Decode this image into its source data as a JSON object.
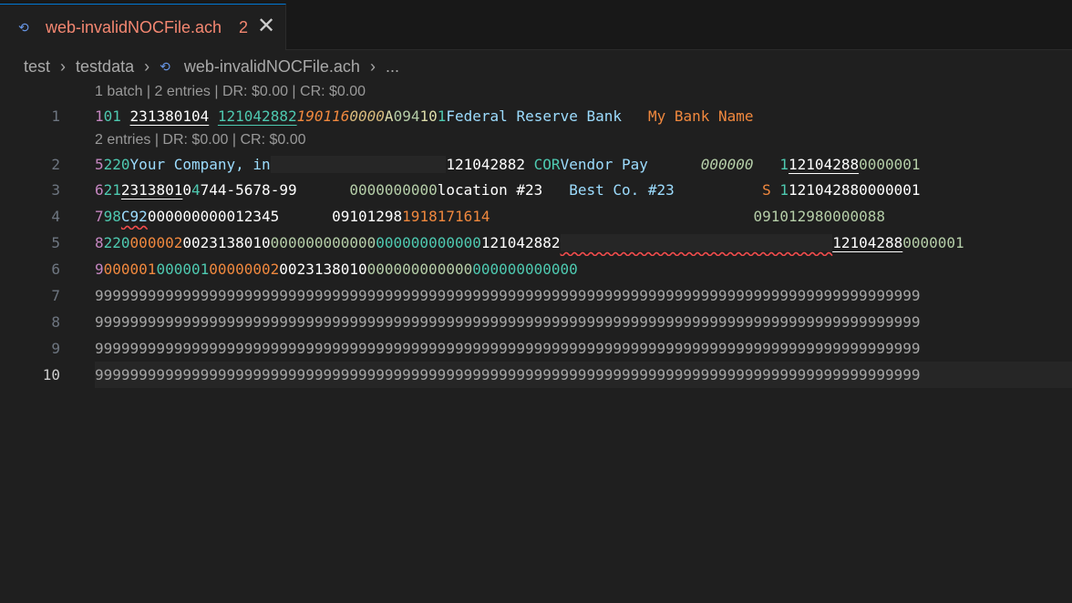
{
  "tab": {
    "icon": "ach-file-icon",
    "filename": "web-invalidNOCFile.ach",
    "problem_count": "2",
    "close_glyph": "✕"
  },
  "breadcrumb": {
    "items": [
      "test",
      "testdata",
      "web-invalidNOCFile.ach",
      "..."
    ]
  },
  "codelens": {
    "line1": "1 batch | 2 entries | DR: $0.00 | CR: $0.00",
    "line2": "2 entries | DR: $0.00 | CR: $0.00"
  },
  "lines": [
    {
      "num": "1",
      "segments": [
        {
          "t": "1",
          "c": "t-pink"
        },
        {
          "t": "01",
          "c": "t-teal"
        },
        {
          "t": " ",
          "c": "t-white"
        },
        {
          "t": "231380104",
          "c": "t-white ul"
        },
        {
          "t": " ",
          "c": "t-white"
        },
        {
          "t": "121042882",
          "c": "t-teal ulg"
        },
        {
          "t": "190116",
          "c": "t-brown it"
        },
        {
          "t": "0000",
          "c": "t-bright it"
        },
        {
          "t": "A",
          "c": "t-yellow"
        },
        {
          "t": "094",
          "c": "t-num"
        },
        {
          "t": "10",
          "c": "t-yellow"
        },
        {
          "t": "1",
          "c": "t-teal"
        },
        {
          "t": "Federal Reserve Bank   ",
          "c": "t-blue"
        },
        {
          "t": "My Bank Name           ",
          "c": "t-brown"
        }
      ]
    },
    {
      "num": "2",
      "segments": [
        {
          "t": "5",
          "c": "t-pink"
        },
        {
          "t": "220",
          "c": "t-teal"
        },
        {
          "t": "Your Company, in",
          "c": "t-blue"
        },
        {
          "t": "                    ",
          "c": "t-blue shade"
        },
        {
          "t": "121042882 ",
          "c": "t-white"
        },
        {
          "t": "COR",
          "c": "t-teal"
        },
        {
          "t": "Vendor Pay      ",
          "c": "t-blue"
        },
        {
          "t": "000000",
          "c": "t-num it"
        },
        {
          "t": "   ",
          "c": "t-white"
        },
        {
          "t": "1",
          "c": "t-teal"
        },
        {
          "t": "12104288",
          "c": "t-white ul"
        },
        {
          "t": "0000001",
          "c": "t-num"
        }
      ]
    },
    {
      "num": "3",
      "segments": [
        {
          "t": "6",
          "c": "t-pink"
        },
        {
          "t": "21",
          "c": "t-teal"
        },
        {
          "t": "2313801",
          "c": "t-white ul"
        },
        {
          "t": "0",
          "c": "t-white"
        },
        {
          "t": "4",
          "c": "t-teal"
        },
        {
          "t": "744-5678-99      ",
          "c": "t-white"
        },
        {
          "t": "0000000000",
          "c": "t-num"
        },
        {
          "t": "location #23   ",
          "c": "t-white"
        },
        {
          "t": "Best Co. #23          ",
          "c": "t-blue"
        },
        {
          "t": "S ",
          "c": "t-brown"
        },
        {
          "t": "1",
          "c": "t-teal"
        },
        {
          "t": "121042880000001",
          "c": "t-white"
        }
      ]
    },
    {
      "num": "4",
      "segments": [
        {
          "t": "7",
          "c": "t-pink"
        },
        {
          "t": "98",
          "c": "t-teal"
        },
        {
          "t": "C92",
          "c": "t-blue squig"
        },
        {
          "t": "000000000012345      ",
          "c": "t-white"
        },
        {
          "t": "09101298",
          "c": "t-white"
        },
        {
          "t": "1918171614",
          "c": "t-brown"
        },
        {
          "t": "                              ",
          "c": "t-white"
        },
        {
          "t": "091012980000088",
          "c": "t-num"
        }
      ]
    },
    {
      "num": "5",
      "segments": [
        {
          "t": "8",
          "c": "t-pink"
        },
        {
          "t": "220",
          "c": "t-teal"
        },
        {
          "t": "000002",
          "c": "t-brown"
        },
        {
          "t": "0023138010",
          "c": "t-white"
        },
        {
          "t": "000000000000",
          "c": "t-num"
        },
        {
          "t": "000000000000",
          "c": "t-teal"
        },
        {
          "t": "121042882",
          "c": "t-white"
        },
        {
          "t": "                               ",
          "c": "t-white shade squig"
        },
        {
          "t": "12104288",
          "c": "t-white ul"
        },
        {
          "t": "0000001",
          "c": "t-num"
        }
      ]
    },
    {
      "num": "6",
      "segments": [
        {
          "t": "9",
          "c": "t-pink"
        },
        {
          "t": "000001",
          "c": "t-brown"
        },
        {
          "t": "000001",
          "c": "t-teal"
        },
        {
          "t": "00000002",
          "c": "t-brown"
        },
        {
          "t": "0023138010",
          "c": "t-white"
        },
        {
          "t": "000000000000",
          "c": "t-num"
        },
        {
          "t": "000000000000",
          "c": "t-teal"
        }
      ]
    },
    {
      "num": "7",
      "segments": [
        {
          "t": "9999999999999999999999999999999999999999999999999999999999999999999999999999999999999999999999",
          "c": "t-gray"
        }
      ]
    },
    {
      "num": "8",
      "segments": [
        {
          "t": "9999999999999999999999999999999999999999999999999999999999999999999999999999999999999999999999",
          "c": "t-gray"
        }
      ]
    },
    {
      "num": "9",
      "segments": [
        {
          "t": "9999999999999999999999999999999999999999999999999999999999999999999999999999999999999999999999",
          "c": "t-gray"
        }
      ]
    },
    {
      "num": "10",
      "segments": [
        {
          "t": "9999999999999999999999999999999999999999999999999999999999999999999999999999999999999999999999",
          "c": "t-gray"
        }
      ]
    }
  ]
}
